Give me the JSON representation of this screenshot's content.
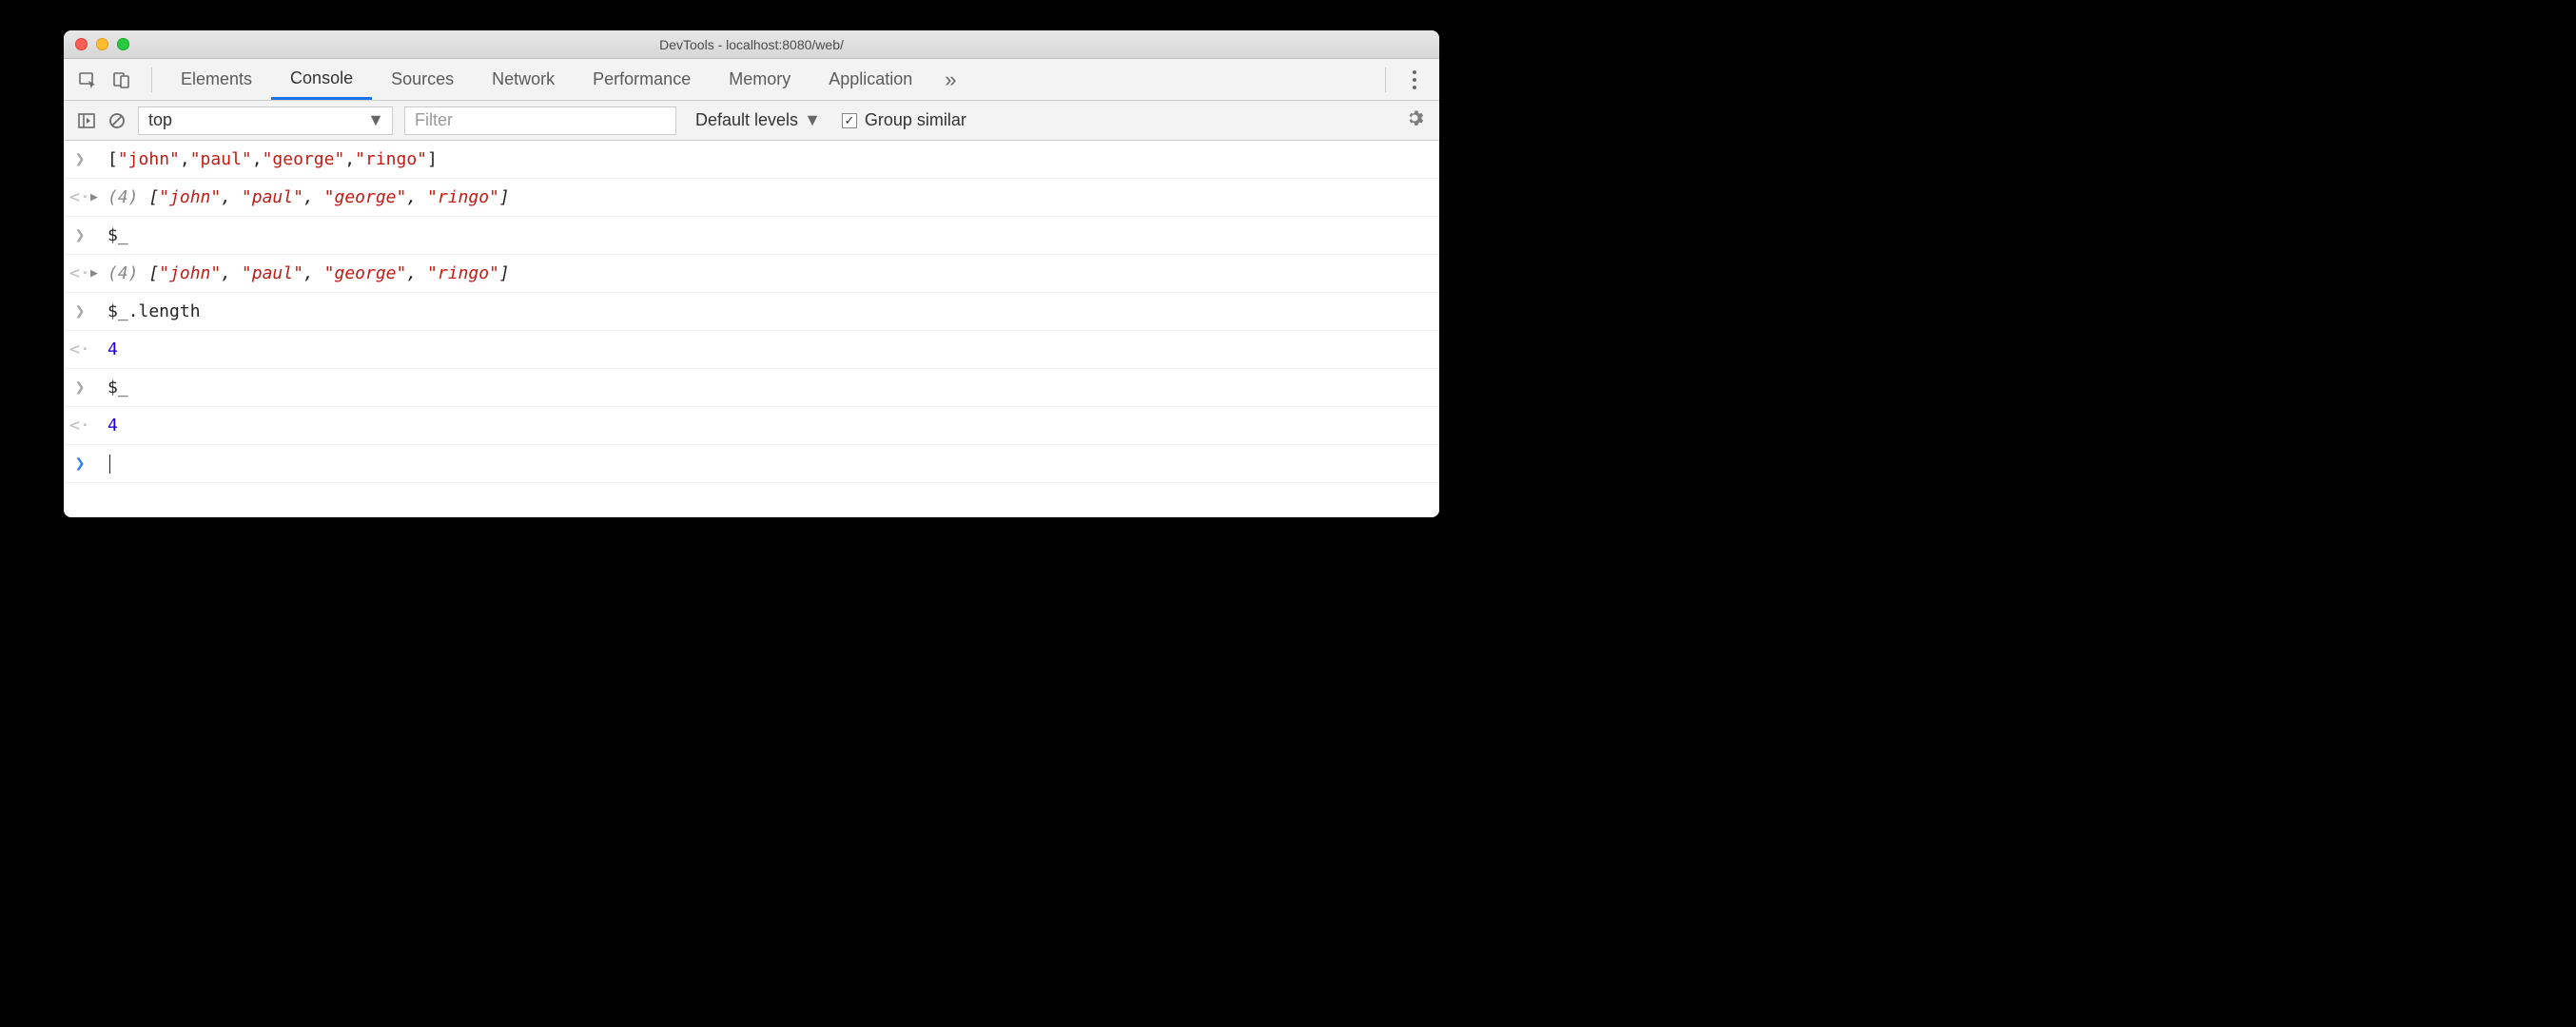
{
  "window": {
    "title": "DevTools - localhost:8080/web/"
  },
  "tabs": {
    "items": [
      "Elements",
      "Console",
      "Sources",
      "Network",
      "Performance",
      "Memory",
      "Application"
    ],
    "active_index": 1
  },
  "context_selector": {
    "value": "top"
  },
  "filter": {
    "placeholder": "Filter",
    "value": ""
  },
  "levels": {
    "label": "Default levels"
  },
  "group_similar": {
    "label": "Group similar",
    "checked": true
  },
  "console_rows": [
    {
      "kind": "input",
      "tokens": [
        {
          "t": "[",
          "c": "punc"
        },
        {
          "t": "\"john\"",
          "c": "str"
        },
        {
          "t": ",",
          "c": "punc"
        },
        {
          "t": "\"paul\"",
          "c": "str"
        },
        {
          "t": ",",
          "c": "punc"
        },
        {
          "t": "\"george\"",
          "c": "str"
        },
        {
          "t": ",",
          "c": "punc"
        },
        {
          "t": "\"ringo\"",
          "c": "str"
        },
        {
          "t": "]",
          "c": "punc"
        }
      ]
    },
    {
      "kind": "output",
      "expandable": true,
      "tokens": [
        {
          "t": "(4) ",
          "c": "dim"
        },
        {
          "t": "[",
          "c": "punc"
        },
        {
          "t": "\"john\"",
          "c": "str"
        },
        {
          "t": ", ",
          "c": "punc"
        },
        {
          "t": "\"paul\"",
          "c": "str"
        },
        {
          "t": ", ",
          "c": "punc"
        },
        {
          "t": "\"george\"",
          "c": "str"
        },
        {
          "t": ", ",
          "c": "punc"
        },
        {
          "t": "\"ringo\"",
          "c": "str"
        },
        {
          "t": "]",
          "c": "punc"
        }
      ]
    },
    {
      "kind": "input",
      "tokens": [
        {
          "t": "$_",
          "c": "plain"
        }
      ]
    },
    {
      "kind": "output",
      "expandable": true,
      "tokens": [
        {
          "t": "(4) ",
          "c": "dim"
        },
        {
          "t": "[",
          "c": "punc"
        },
        {
          "t": "\"john\"",
          "c": "str"
        },
        {
          "t": ", ",
          "c": "punc"
        },
        {
          "t": "\"paul\"",
          "c": "str"
        },
        {
          "t": ", ",
          "c": "punc"
        },
        {
          "t": "\"george\"",
          "c": "str"
        },
        {
          "t": ", ",
          "c": "punc"
        },
        {
          "t": "\"ringo\"",
          "c": "str"
        },
        {
          "t": "]",
          "c": "punc"
        }
      ]
    },
    {
      "kind": "input",
      "tokens": [
        {
          "t": "$_.length",
          "c": "plain"
        }
      ]
    },
    {
      "kind": "output",
      "tokens": [
        {
          "t": "4",
          "c": "num"
        }
      ]
    },
    {
      "kind": "input",
      "tokens": [
        {
          "t": "$_",
          "c": "plain"
        }
      ]
    },
    {
      "kind": "output",
      "tokens": [
        {
          "t": "4",
          "c": "num"
        }
      ]
    },
    {
      "kind": "prompt"
    }
  ]
}
